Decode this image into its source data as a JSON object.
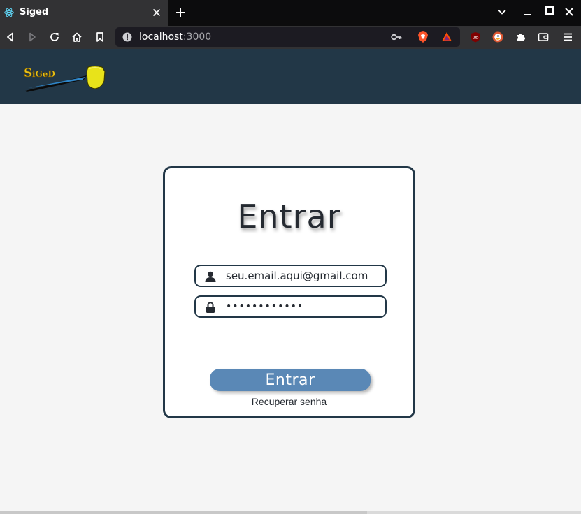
{
  "browser": {
    "tab_title": "Siged",
    "url_host": "localhost",
    "url_port": ":3000",
    "icons": [
      "react-favicon",
      "close-icon",
      "plus-icon",
      "chevron-down-icon",
      "minimize-icon",
      "maximize-icon",
      "back-icon",
      "forward-icon",
      "reload-icon",
      "home-icon",
      "bookmark-icon",
      "info-icon",
      "key-icon",
      "brave-shield-icon",
      "bat-rewards-icon",
      "ublock-icon",
      "duckduckgo-icon",
      "puzzle-icon",
      "wallet-icon",
      "menu-icon"
    ]
  },
  "app": {
    "logo_text": "SiGeD",
    "header_color": "#223747"
  },
  "login": {
    "title": "Entrar",
    "email_value": "seu.email.aqui@gmail.com",
    "password_value": "••••••••••••",
    "submit_label": "Entrar",
    "recover_label": "Recuperar senha",
    "button_color": "#5a88b6"
  }
}
